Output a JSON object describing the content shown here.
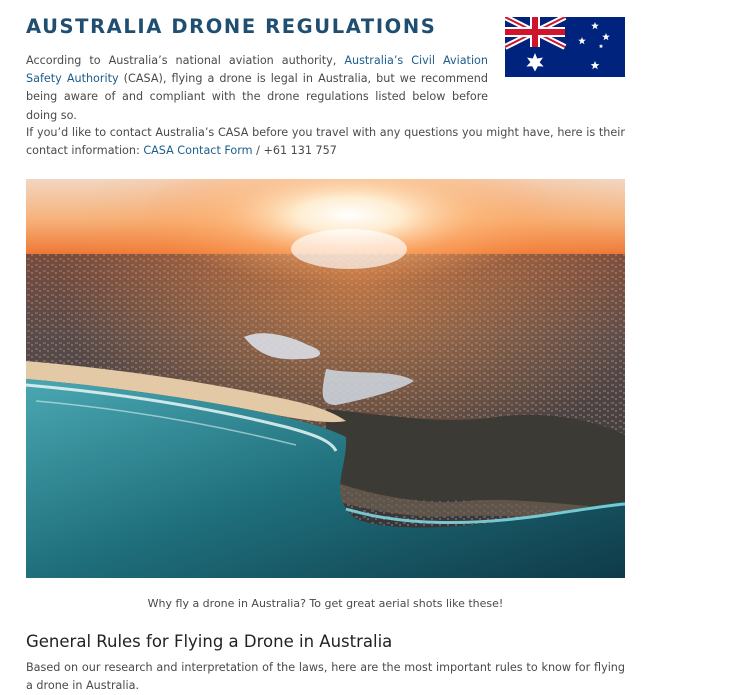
{
  "header": {
    "title": "AUSTRALIA DRONE REGULATIONS",
    "flag_icon": "australia-flag-icon"
  },
  "intro": {
    "text_before_link": "According to Australia’s national aviation authority, ",
    "link_text": "Australia’s Civil Aviation Safety Authority",
    "text_after_link": " (CASA), flying a drone is legal in Australia, but we recommend being aware of and compliant with the drone regulations listed below before doing so."
  },
  "contact": {
    "text_before_link": "If you’d like to contact Australia’s CASA before you travel with any questions you might have, here is their contact information: ",
    "link_text": "CASA Contact Form",
    "text_after_link": " / +61 131 757"
  },
  "photo": {
    "caption": "Why fly a drone in Australia? To get great aerial shots like these!"
  },
  "section": {
    "title": "General Rules for Flying a Drone in Australia",
    "text": "Based on our research and interpretation of the laws, here are the most important rules to know for flying a drone in Australia."
  },
  "colors": {
    "title": "#1f4e70",
    "link": "#1d5d8e",
    "body_text": "#4a4a4a"
  }
}
